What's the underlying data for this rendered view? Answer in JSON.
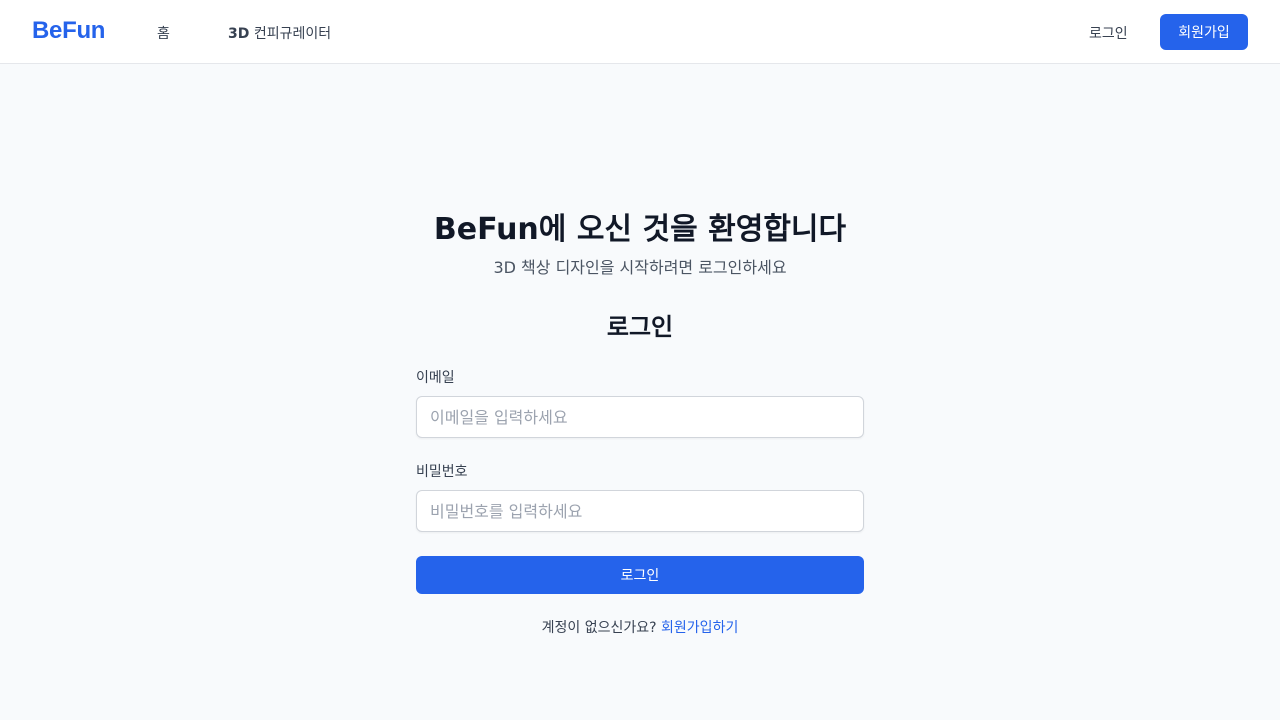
{
  "header": {
    "logo": "BeFun",
    "nav": {
      "home": "홈",
      "configurator_prefix": "3D",
      "configurator_rest": " 컨피규레이터"
    },
    "login": "로그인",
    "signup": "회원가입"
  },
  "welcome": {
    "title": "BeFun에 오신 것을 환영합니다",
    "subtitle": "3D 책상 디자인을 시작하려면 로그인하세요"
  },
  "form": {
    "title": "로그인",
    "email_label": "이메일",
    "email_placeholder": "이메일을 입력하세요",
    "email_value": "",
    "password_label": "비밀번호",
    "password_placeholder": "비밀번호를 입력하세요",
    "password_value": "",
    "submit": "로그인",
    "no_account": "계정이 없으신가요?",
    "signup_link": "회원가입하기"
  },
  "colors": {
    "accent": "#2563eb",
    "background": "#f8fafc"
  }
}
